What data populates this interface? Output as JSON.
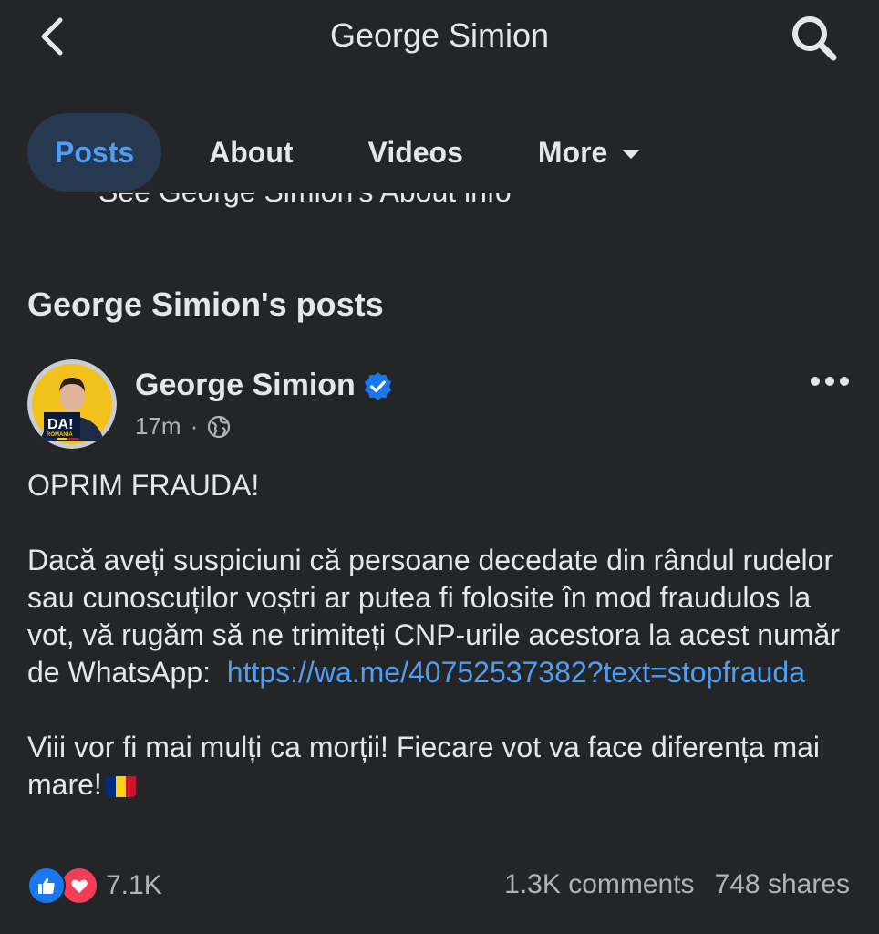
{
  "header": {
    "title": "George Simion",
    "back_icon": "chevron-left-icon",
    "search_icon": "search-icon"
  },
  "tabs": [
    {
      "label": "Posts",
      "active": true
    },
    {
      "label": "About",
      "active": false
    },
    {
      "label": "Videos",
      "active": false
    },
    {
      "label": "More",
      "active": false
    }
  ],
  "clipped_text": "See George Simion's About info",
  "section_title": "George Simion's posts",
  "post": {
    "author": "George Simion",
    "verified": true,
    "time": "17m",
    "audience_icon": "globe-icon",
    "avatar_badge": "DA!",
    "avatar_badge_sub": "ROMÂNIA",
    "text_line1": "OPRIM FRAUDA!",
    "text_para2": "Dacă aveți suspiciuni că persoane decedate din rândul rudelor sau cunoscuților voștri ar putea fi folosite în mod fraudulos la vot, vă rugăm să ne trimiteți CNP-urile acestora la acest număr de WhatsApp:",
    "link": "https://wa.me/40752537382?text=stopfrauda",
    "text_para3": "Viii vor fi mai mulți ca morții! Fiecare vot va face diferența mai mare!",
    "flag_icon": "romania-flag-icon",
    "reaction_count": "7.1K",
    "comments": "1.3K comments",
    "shares": "748 shares"
  },
  "colors": {
    "background": "#242526",
    "text": "#e4e6eb",
    "muted": "#b0b3b8",
    "accent": "#4e9ef6",
    "active_tab_bg": "#263951",
    "like": "#1877f2",
    "love": "#f33e58"
  }
}
